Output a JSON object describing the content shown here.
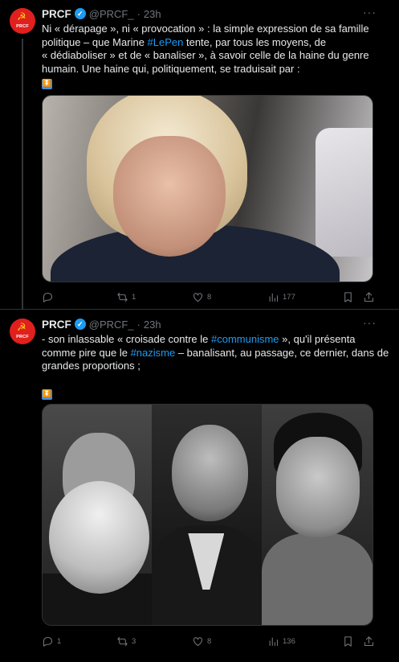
{
  "tweets": [
    {
      "name": "PRCF",
      "handle": "@PRCF_",
      "dot": "·",
      "time": "23h",
      "avatar_text": "PRCF",
      "text_lines": [
        [
          {
            "t": "Ni « dérapage », ni « provocation » : la simple expression de sa famille"
          }
        ],
        [
          {
            "t": "politique – que Marine "
          },
          {
            "t": "#LePen",
            "hl": true
          },
          {
            "t": " tente, par tous les moyens, de"
          }
        ],
        [
          {
            "t": "« dédiaboliser » et de « banaliser », à savoir celle de la haine du genre"
          }
        ],
        [
          {
            "t": "humain. Une haine qui, politiquement, se traduisait par :"
          }
        ]
      ],
      "emoji": "⏬",
      "actions": {
        "reply": "",
        "retweet": "1",
        "like": "8",
        "views": "177"
      }
    },
    {
      "name": "PRCF",
      "handle": "@PRCF_",
      "dot": "·",
      "time": "23h",
      "avatar_text": "PRCF",
      "text_lines": [
        [
          {
            "t": "- son inlassable « croisade contre le "
          },
          {
            "t": "#communisme",
            "hl": true
          },
          {
            "t": " », qu'il présenta"
          }
        ],
        [
          {
            "t": "comme pire que le "
          },
          {
            "t": "#nazisme",
            "hl": true
          },
          {
            "t": " – banalisant, au passage, ce dernier, dans de"
          }
        ],
        [
          {
            "t": "grandes proportions ;"
          }
        ]
      ],
      "emoji": "⏬",
      "actions": {
        "reply": "1",
        "retweet": "3",
        "like": "8",
        "views": "136"
      }
    }
  ]
}
